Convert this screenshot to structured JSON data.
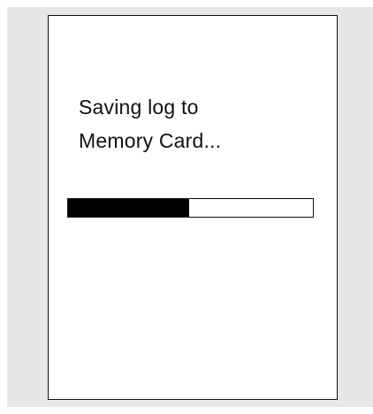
{
  "dialog": {
    "message_line1": "Saving log to",
    "message_line2": "Memory Card...",
    "progress_fraction": 0.495
  },
  "colors": {
    "backdrop": "#e7e7e7",
    "screen_background": "#ffffff",
    "ink": "#111111",
    "progress_fill": "#000000"
  }
}
